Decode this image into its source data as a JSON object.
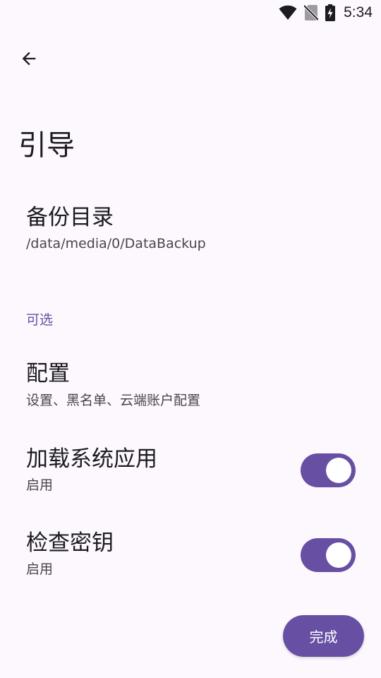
{
  "status_bar": {
    "time": "5:34",
    "icons": [
      "wifi-icon",
      "no-sim-icon",
      "battery-charging-icon"
    ]
  },
  "header": {
    "back_icon": "arrow-back-icon",
    "title": "引导"
  },
  "preferences": {
    "backup_dir": {
      "title": "备份目录",
      "summary": "/data/media/0/DataBackup"
    },
    "optional_category": "可选",
    "config": {
      "title": "配置",
      "summary": "设置、黑名单、云端账户配置"
    },
    "load_system_apps": {
      "title": "加载系统应用",
      "summary": "启用",
      "enabled": true
    },
    "check_keys": {
      "title": "检查密钥",
      "summary": "启用",
      "enabled": true
    }
  },
  "actions": {
    "done_label": "完成"
  },
  "colors": {
    "background": "#fdf8fd",
    "accent": "#6750a4",
    "text_primary": "#1c1b1f",
    "text_secondary": "#49454f"
  }
}
